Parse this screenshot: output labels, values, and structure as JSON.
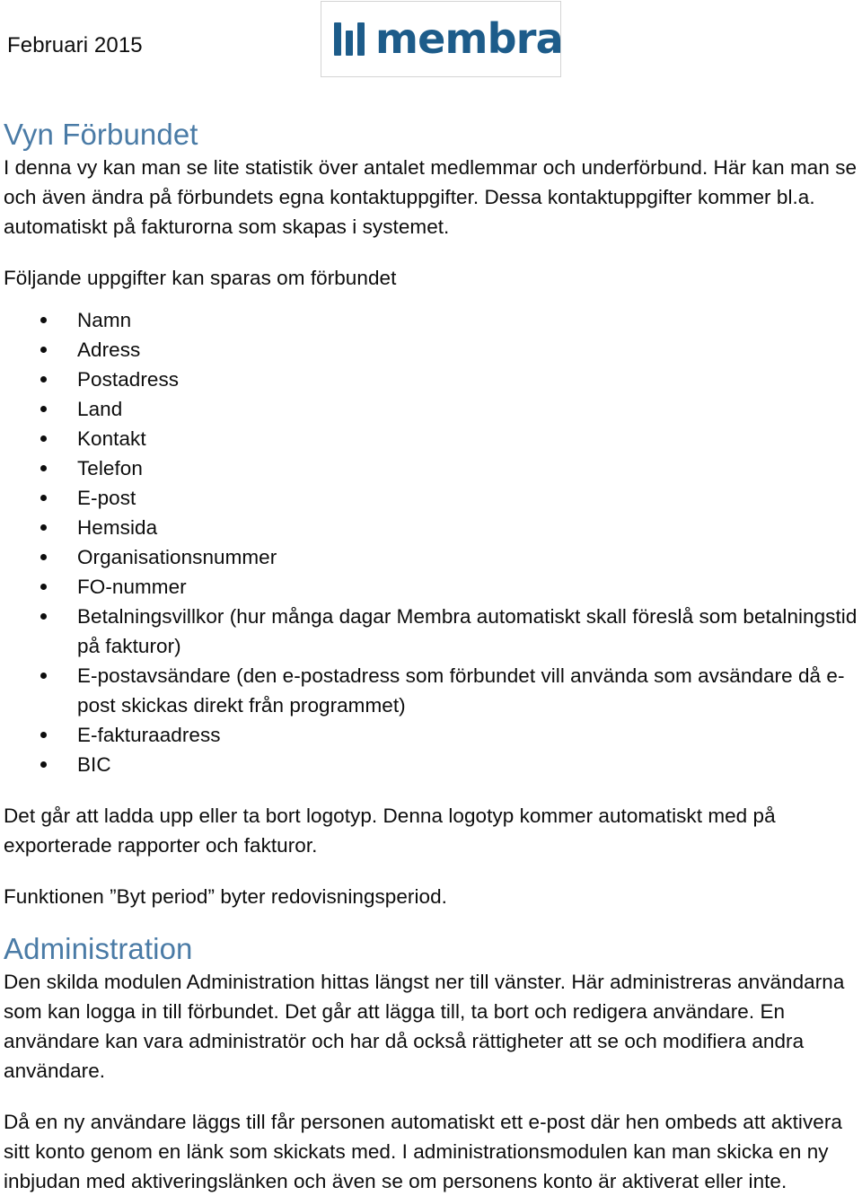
{
  "document": {
    "header": {
      "date_label": "Februari 2015",
      "logo": {
        "icon_name": "membra-bars-icon",
        "wordmark": "membra",
        "color": "#1d5c8a"
      }
    },
    "colors": {
      "heading": "#4a7ba6",
      "body_text": "#0d0d0d",
      "brand": "#1d5c8a",
      "logo_box_border": "#d4d4d4",
      "page_background": "#ffffff"
    },
    "sections": [
      {
        "id": "vyn-forbundet",
        "heading": "Vyn Förbundet",
        "intro_paragraph": "I denna vy kan man se lite statistik över antalet medlemmar och underförbund. Här kan man se och även ändra på förbundets egna kontaktuppgifter. Dessa kontaktuppgifter kommer bl.a. automatiskt på fakturorna som skapas i systemet.",
        "list_intro": "Följande uppgifter kan sparas om förbundet",
        "list_items": [
          "Namn",
          "Adress",
          "Postadress",
          "Land",
          "Kontakt",
          "Telefon",
          "E-post",
          "Hemsida",
          "Organisationsnummer",
          "FO-nummer",
          "Betalningsvillkor (hur många dagar Membra automatiskt skall föreslå som betalningstid på fakturor)",
          "E-postavsändare (den e-postadress som förbundet vill använda som avsändare då e-post skickas direkt från programmet)",
          "E-fakturaadress",
          "BIC"
        ],
        "paragraph_logo": "Det går att ladda upp eller ta bort logotyp. Denna logotyp kommer automatiskt med på exporterade rapporter och fakturor.",
        "paragraph_function": "Funktionen ”Byt period” byter redovisningsperiod."
      },
      {
        "id": "administration",
        "heading": "Administration",
        "paragraph_one": "Den skilda modulen Administration hittas längst ner till vänster. Här administreras användarna som kan logga in till förbundet. Det går att lägga till, ta bort och redigera användare. En användare kan vara administratör och har då också rättigheter att se och modifiera andra användare.",
        "paragraph_two": "Då en ny användare läggs till får personen automatiskt ett e-post där hen ombeds att aktivera sitt konto genom en länk som skickats med. I administrationsmodulen kan man skicka en ny inbjudan med aktiveringslänken och även se om personens konto är aktiverat eller inte."
      }
    ]
  }
}
